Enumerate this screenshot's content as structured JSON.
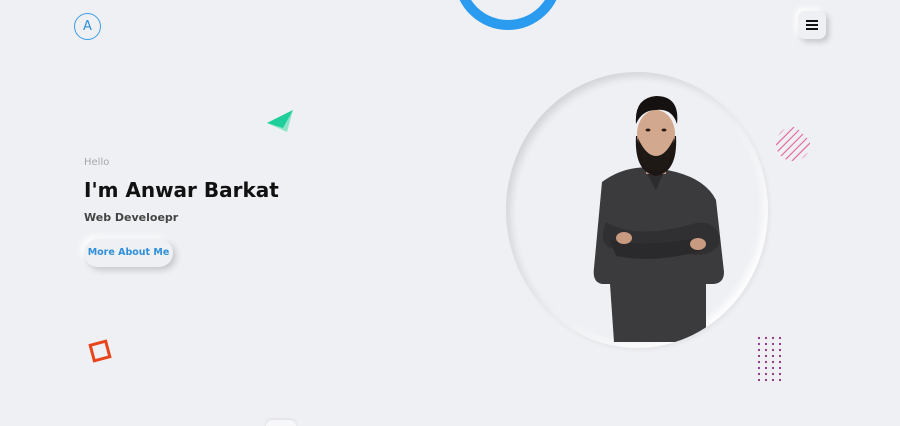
{
  "header": {
    "logo_letter": "A",
    "menu_icon": "hamburger-icon"
  },
  "hero": {
    "greeting": "Hello",
    "name": "I'm Anwar Barkat",
    "role": "Web Develoepr",
    "cta_label": "More About Me"
  },
  "colors": {
    "background": "#eff0f4",
    "accent_blue": "#2b9bf0",
    "triangle_green": "#1fcf9b",
    "square_orange": "#e8451d",
    "pink_lines": "#e36aa2",
    "purple_dots": "#8a2a7c"
  }
}
